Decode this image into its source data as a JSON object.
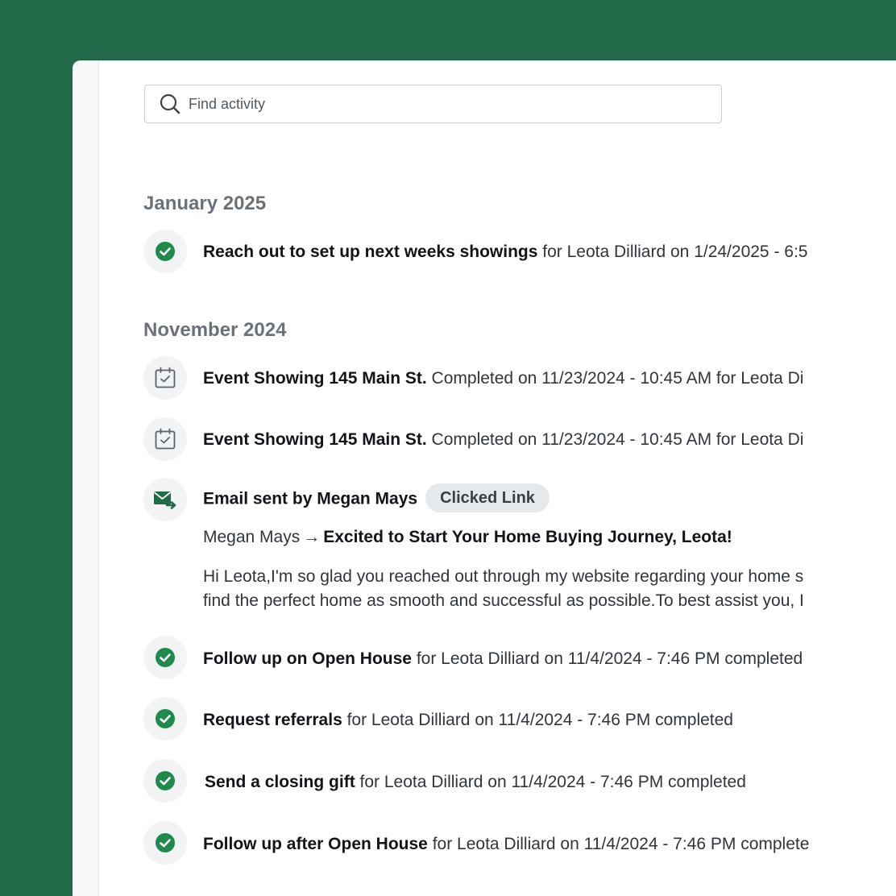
{
  "search": {
    "placeholder": "Find activity"
  },
  "colors": {
    "brand_green": "#22694a",
    "check_green": "#1f8a4c"
  },
  "groups": [
    {
      "month": "January 2025",
      "items": [
        {
          "icon": "check-circle-icon",
          "title": "Reach out to set up next weeks showings",
          "rest": " for Leota Dilliard on 1/24/2025 - 6:5"
        }
      ]
    },
    {
      "month": "November 2024",
      "items": [
        {
          "icon": "calendar-check-icon",
          "title": "Event Showing 145 Main St.",
          "rest": " Completed on 11/23/2024 - 10:45 AM for Leota Di"
        },
        {
          "icon": "calendar-check-icon",
          "title": "Event Showing 145 Main St.",
          "rest": " Completed on 11/23/2024 - 10:45 AM for Leota Di"
        },
        {
          "icon": "email-sent-icon",
          "title": "Email sent by Megan Mays",
          "badge": "Clicked Link",
          "sender": "Megan Mays",
          "arrow": "→",
          "subject": "Excited to Start Your Home Buying Journey, Leota!",
          "body_line1": "Hi Leota,I'm so glad you reached out through my website regarding your home s",
          "body_line2": "find the perfect home as smooth and successful as possible.To best assist you, I"
        },
        {
          "icon": "check-circle-icon",
          "title": "Follow up on Open House",
          "rest": " for Leota Dilliard on 11/4/2024 - 7:46 PM completed"
        },
        {
          "icon": "check-circle-icon",
          "title": "Request referrals",
          "rest": " for Leota Dilliard on 11/4/2024 - 7:46 PM completed"
        },
        {
          "icon": "check-circle-icon",
          "title": "Send a closing gift",
          "rest": " for Leota Dilliard on 11/4/2024 - 7:46 PM completed"
        },
        {
          "icon": "check-circle-icon",
          "title": "Follow up after Open House",
          "rest": " for Leota Dilliard on 11/4/2024 - 7:46 PM complete"
        }
      ]
    }
  ]
}
